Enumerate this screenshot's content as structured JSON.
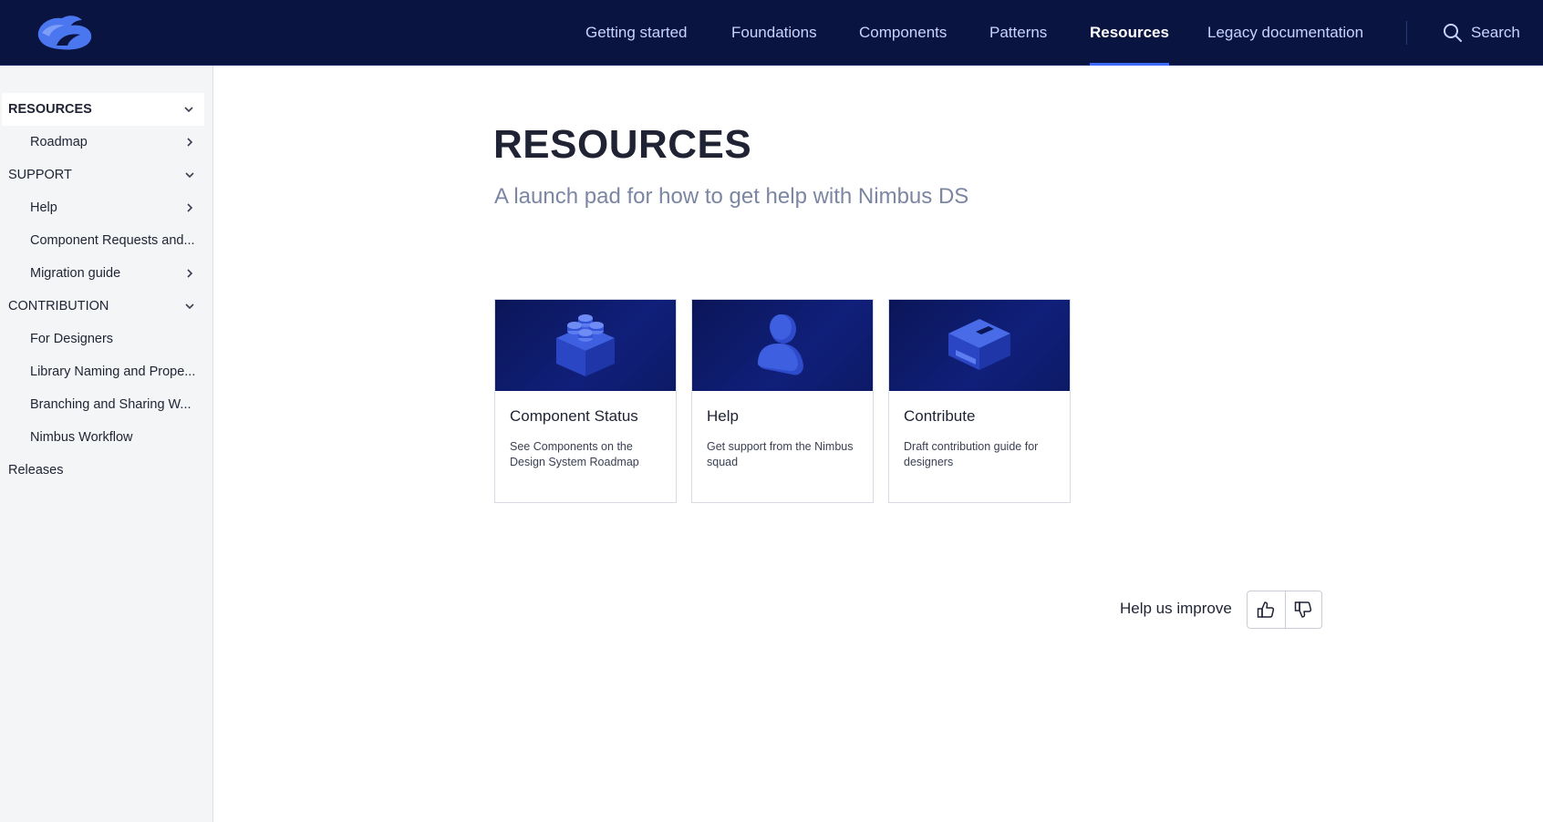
{
  "header": {
    "nav": [
      {
        "label": "Getting started"
      },
      {
        "label": "Foundations"
      },
      {
        "label": "Components"
      },
      {
        "label": "Patterns"
      },
      {
        "label": "Resources",
        "active": true
      },
      {
        "label": "Legacy documentation"
      }
    ],
    "search_label": "Search"
  },
  "sidebar": {
    "items": [
      {
        "label": "RESOURCES",
        "level": "section",
        "chevron": "down"
      },
      {
        "label": "Roadmap",
        "level": "sub",
        "chevron": "right"
      },
      {
        "label": "SUPPORT",
        "level": "section",
        "chevron": "down"
      },
      {
        "label": "Help",
        "level": "sub",
        "chevron": "right"
      },
      {
        "label": "Component Requests and...",
        "level": "sub"
      },
      {
        "label": "Migration guide",
        "level": "sub",
        "chevron": "right"
      },
      {
        "label": "CONTRIBUTION",
        "level": "section",
        "chevron": "down"
      },
      {
        "label": "For Designers",
        "level": "sub"
      },
      {
        "label": "Library Naming and Prope...",
        "level": "sub"
      },
      {
        "label": "Branching and Sharing W...",
        "level": "sub"
      },
      {
        "label": "Nimbus Workflow",
        "level": "sub"
      },
      {
        "label": "Releases",
        "level": "section"
      }
    ]
  },
  "main": {
    "title": "RESOURCES",
    "subtitle": "A launch pad for how to get help with Nimbus DS",
    "cards": [
      {
        "title": "Component Status",
        "description": "See Components on the Design System Roadmap",
        "icon": "lego-block-icon"
      },
      {
        "title": "Help",
        "description": "Get support from the Nimbus squad",
        "icon": "person-icon"
      },
      {
        "title": "Contribute",
        "description": "Draft contribution guide for designers",
        "icon": "box-icon"
      }
    ],
    "feedback": {
      "label": "Help us improve"
    }
  },
  "colors": {
    "header_bg": "#0a1440",
    "accent": "#3d6bff",
    "sidebar_bg": "#f4f5f7",
    "card_image_bg": "#0f1d72"
  }
}
